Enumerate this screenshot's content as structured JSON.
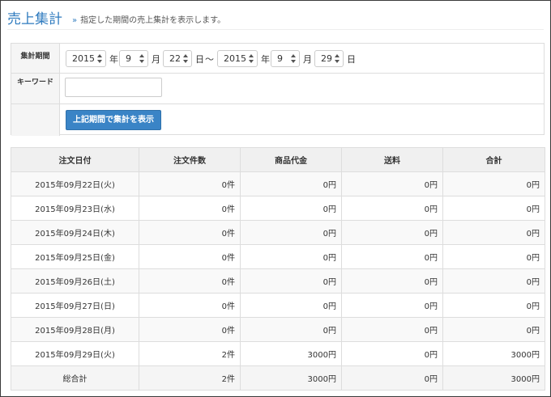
{
  "header": {
    "title": "売上集計",
    "chevron": "»",
    "subtitle": "指定した期間の売上集計を表示します。"
  },
  "search": {
    "period_label": "集計期間",
    "from": {
      "year": "2015",
      "month": "9",
      "day": "22"
    },
    "to": {
      "year": "2015",
      "month": "9",
      "day": "29"
    },
    "unit_year": "年",
    "unit_month": "月",
    "unit_day": "日",
    "separator": "〜",
    "keyword_label": "キーワード",
    "keyword_value": "",
    "submit_label": "上記期間で集計を表示"
  },
  "table": {
    "headers": [
      "注文日付",
      "注文件数",
      "商品代金",
      "送料",
      "合計"
    ],
    "rows": [
      [
        "2015年09月22日(火)",
        "0件",
        "0円",
        "0円",
        "0円"
      ],
      [
        "2015年09月23日(水)",
        "0件",
        "0円",
        "0円",
        "0円"
      ],
      [
        "2015年09月24日(木)",
        "0件",
        "0円",
        "0円",
        "0円"
      ],
      [
        "2015年09月25日(金)",
        "0件",
        "0円",
        "0円",
        "0円"
      ],
      [
        "2015年09月26日(土)",
        "0件",
        "0円",
        "0円",
        "0円"
      ],
      [
        "2015年09月27日(日)",
        "0件",
        "0円",
        "0円",
        "0円"
      ],
      [
        "2015年09月28日(月)",
        "0件",
        "0円",
        "0円",
        "0円"
      ],
      [
        "2015年09月29日(火)",
        "2件",
        "3000円",
        "0円",
        "3000円"
      ]
    ],
    "total": [
      "総合計",
      "2件",
      "3000円",
      "0円",
      "3000円"
    ]
  },
  "colors": {
    "accent": "#2f7bbf",
    "button": "#3a84c6"
  }
}
